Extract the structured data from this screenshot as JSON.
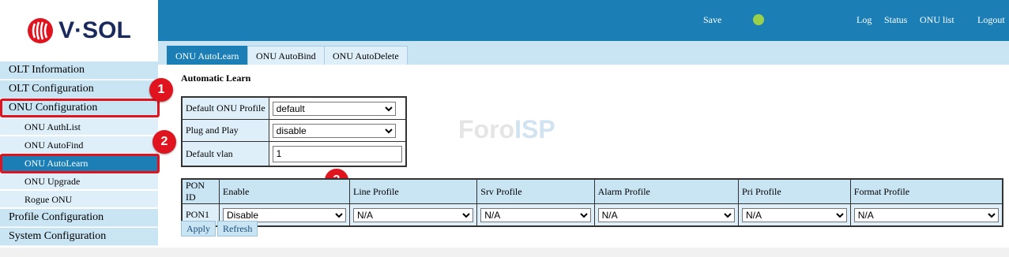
{
  "brand": {
    "logo_text": "V·SOL"
  },
  "topbar": {
    "save_label": "Save",
    "status_color": "#9ad14a",
    "links": [
      "Log",
      "Status",
      "ONU list",
      "Logout"
    ]
  },
  "tabs": [
    "ONU AutoLearn",
    "ONU AutoBind",
    "ONU AutoDelete"
  ],
  "sidebar": {
    "items": [
      "OLT Information",
      "OLT Configuration",
      "ONU Configuration"
    ],
    "sub_items": [
      "ONU AuthList",
      "ONU AutoFind",
      "ONU AutoLearn",
      "ONU Upgrade",
      "Rogue ONU"
    ],
    "bottom_items": [
      "Profile Configuration",
      "System Configuration"
    ]
  },
  "annotations": [
    "1",
    "2",
    "3"
  ],
  "section": {
    "title": "Automatic Learn"
  },
  "config": {
    "default_onu_profile_label": "Default ONU Profile",
    "default_onu_profile_value": "default",
    "plug_and_play_label": "Plug and Play",
    "plug_and_play_value": "disable",
    "default_vlan_label": "Default vlan",
    "default_vlan_value": "1"
  },
  "pon_table": {
    "headers": [
      "PON ID",
      "Enable",
      "Line Profile",
      "Srv Profile",
      "Alarm Profile",
      "Pri Profile",
      "Format Profile"
    ],
    "rows": [
      {
        "pon_id": "PON1",
        "enable": "Disable",
        "line": "N/A",
        "srv": "N/A",
        "alarm": "N/A",
        "pri": "N/A",
        "format": "N/A"
      }
    ]
  },
  "buttons": {
    "apply": "Apply",
    "refresh": "Refresh"
  },
  "watermark": {
    "left": "Foro",
    "right": "ISP"
  },
  "colors": {
    "header_blue": "#1b7fb6",
    "highlight_red": "#e0141e",
    "sidebar_bg": "#c9e4f3"
  }
}
